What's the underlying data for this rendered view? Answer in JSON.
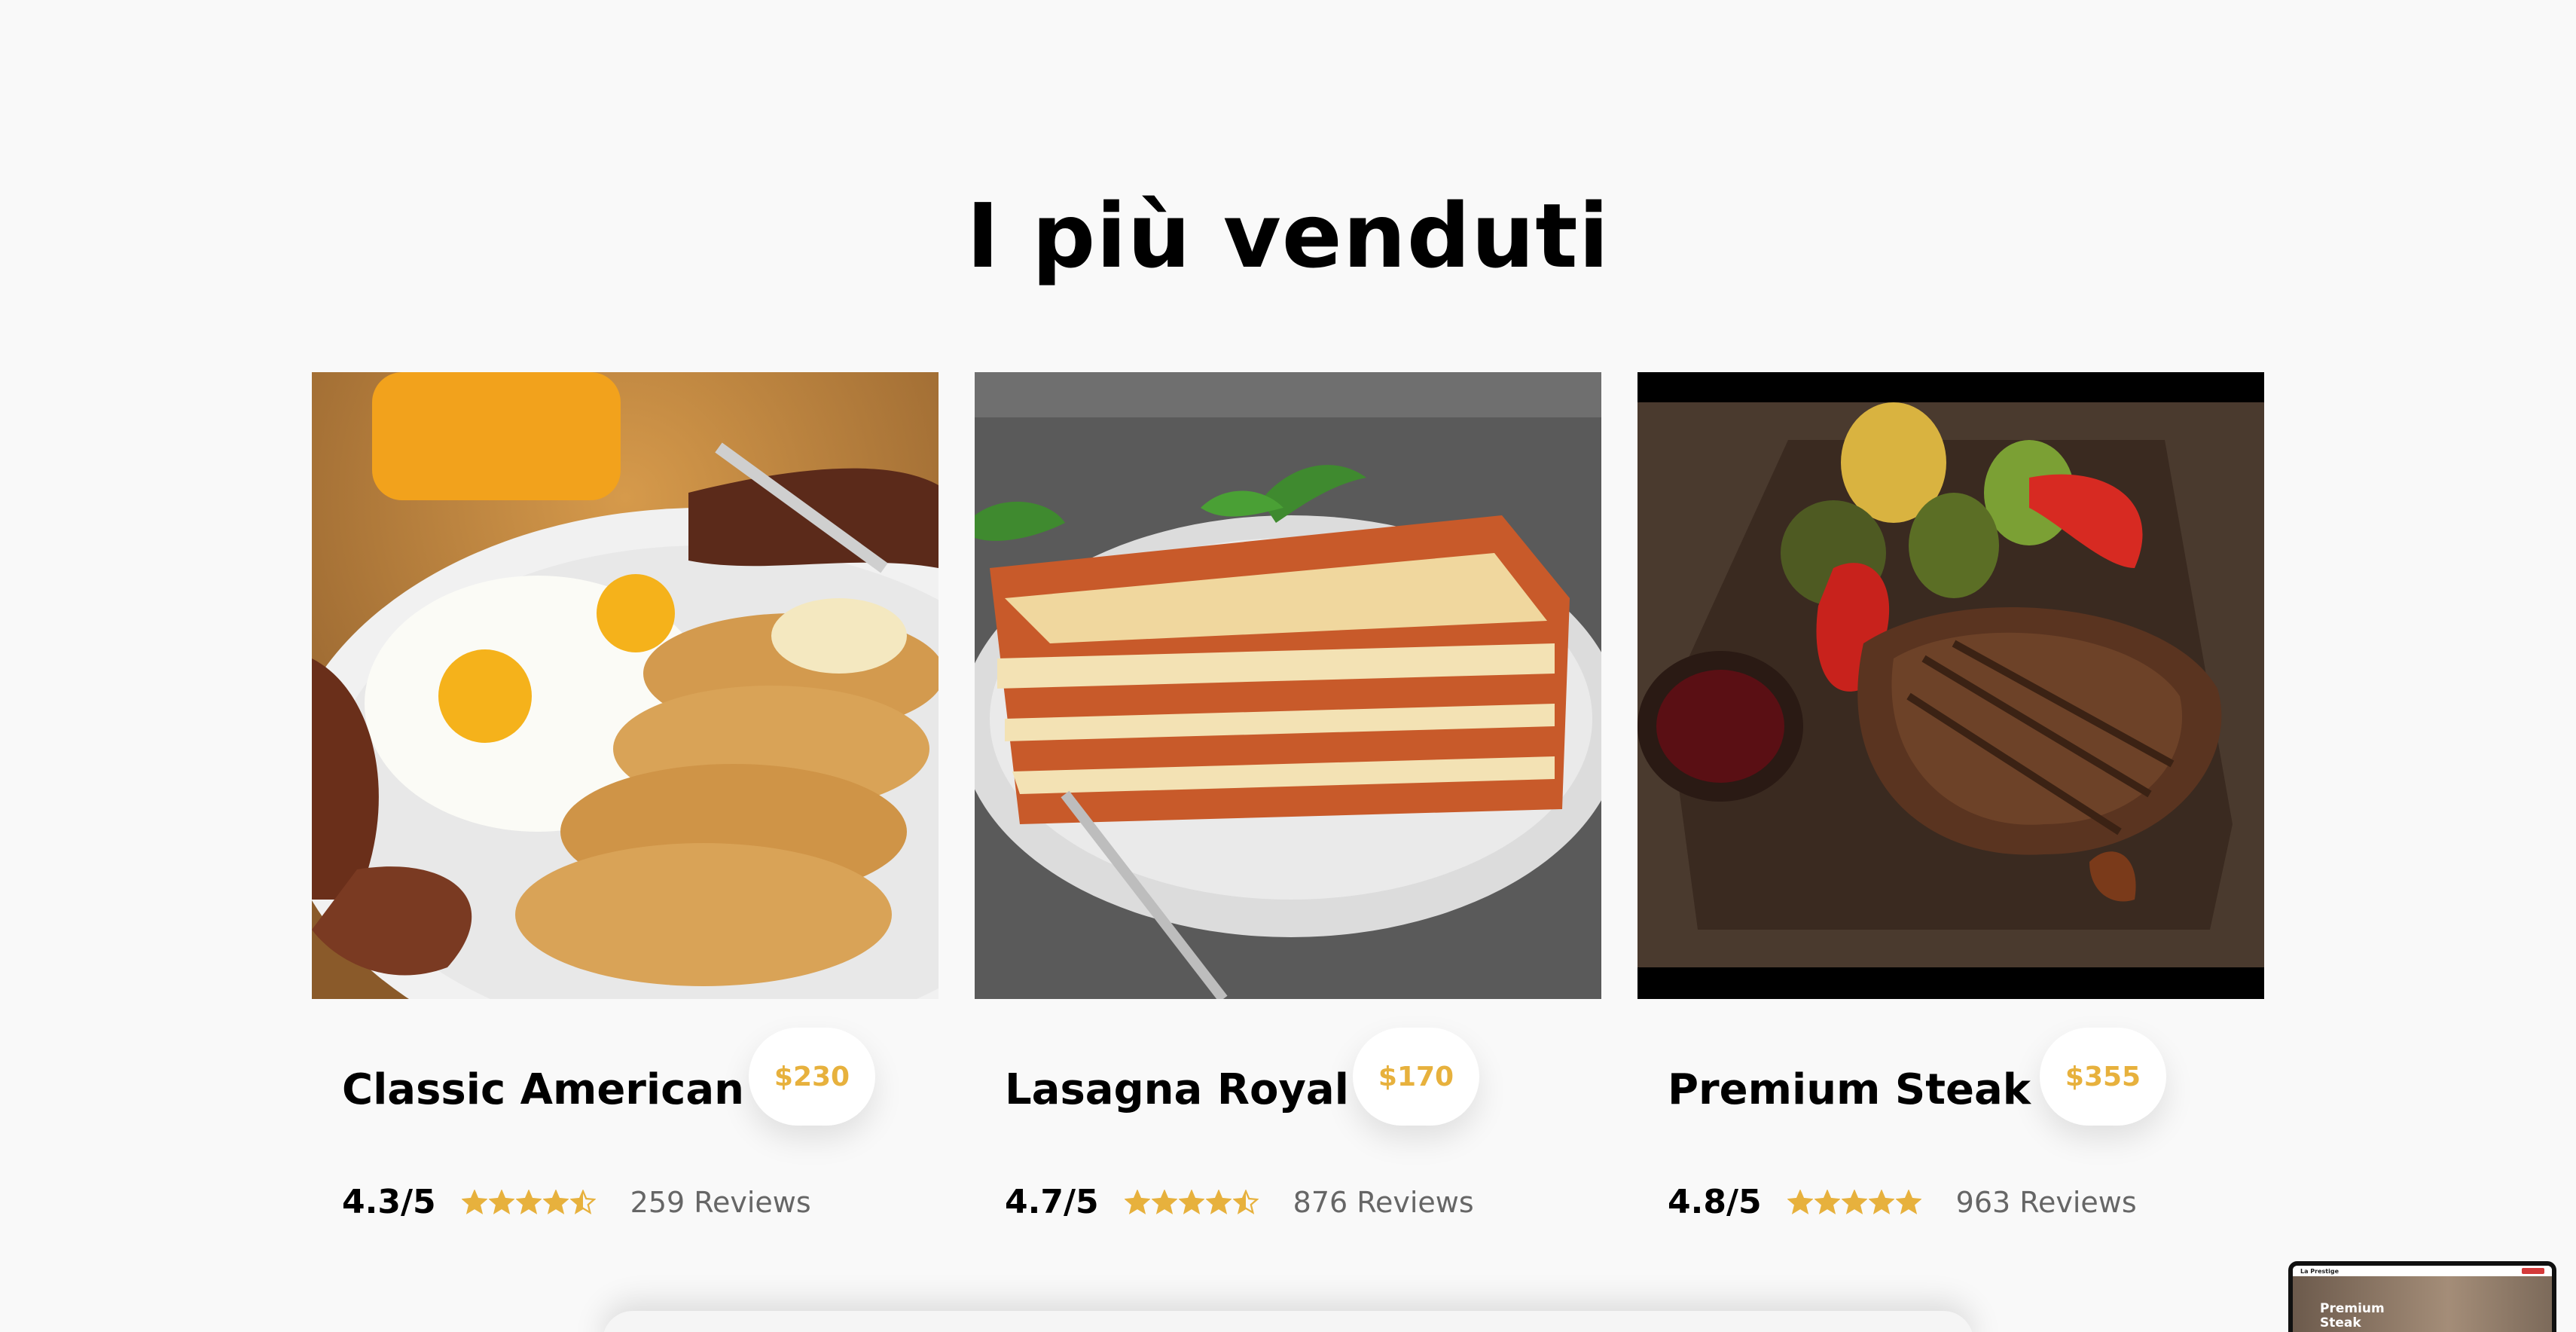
{
  "section": {
    "title": "I più venduti"
  },
  "products": [
    {
      "name": "Classic American",
      "price": "$230",
      "score": "4.3/5",
      "rating": 4.3,
      "reviews": "259 Reviews"
    },
    {
      "name": "Lasagna Royal",
      "price": "$170",
      "score": "4.7/5",
      "rating": 4.7,
      "reviews": "876 Reviews"
    },
    {
      "name": "Premium Steak",
      "price": "$355",
      "score": "4.8/5",
      "rating": 4.8,
      "reviews": "963 Reviews"
    }
  ],
  "preview": {
    "logo": "La Prestige",
    "hero_text": "Premium Steak"
  },
  "colors": {
    "accent": "#e7b13d",
    "background": "#f9f9f9",
    "text": "#000000",
    "muted": "#666666"
  },
  "icons": {
    "star_full": "star-icon",
    "star_half": "half-star-icon",
    "star_empty": "empty-star-icon"
  }
}
